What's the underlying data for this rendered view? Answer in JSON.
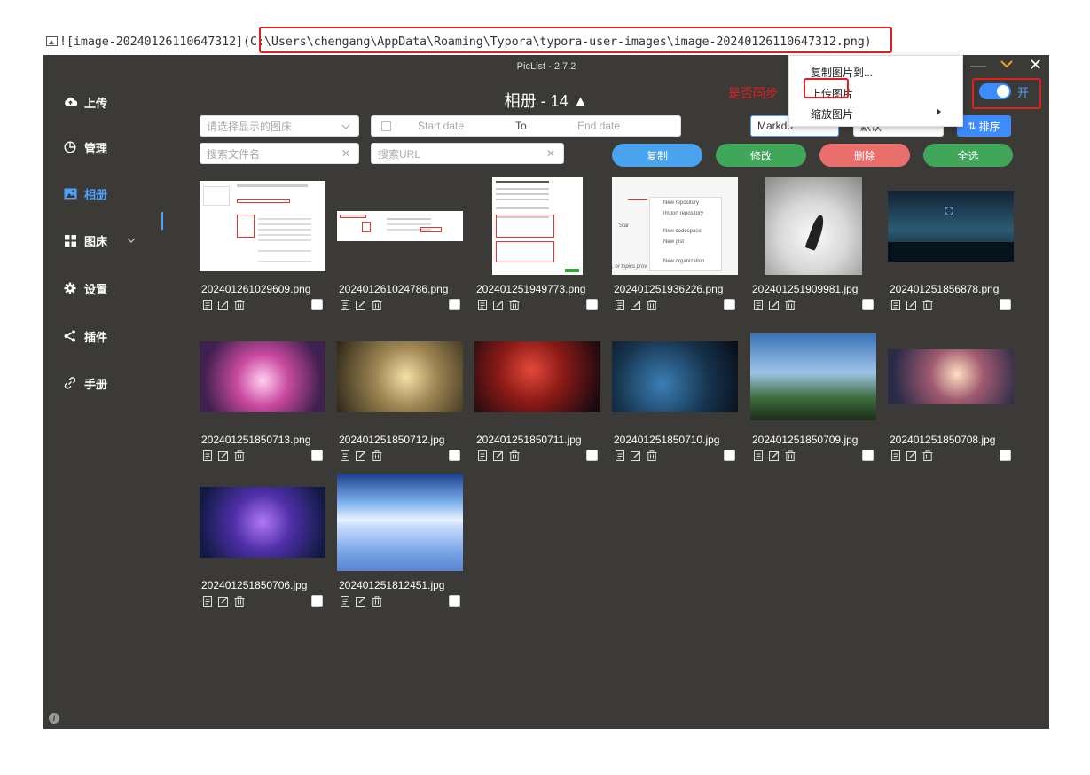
{
  "markdown": {
    "icon": "image-file-icon",
    "prefix": "![image-20240126110647312]",
    "path": "(C:\\Users\\chengang\\AppData\\Roaming\\Typora\\typora-user-images\\image-20240126110647312.png)"
  },
  "window": {
    "title": "PicList - 2.7.2",
    "controls": [
      "minimize-icon",
      "collapse-icon",
      "close-icon"
    ]
  },
  "sidebar": {
    "items": [
      {
        "label": "上传",
        "icon": "cloud-upload-icon"
      },
      {
        "label": "管理",
        "icon": "pie-chart-icon"
      },
      {
        "label": "相册",
        "icon": "picture-icon"
      },
      {
        "label": "图床",
        "icon": "grid-icon"
      },
      {
        "label": "设置",
        "icon": "gear-icon"
      },
      {
        "label": "插件",
        "icon": "share-icon"
      },
      {
        "label": "手册",
        "icon": "link-icon"
      }
    ],
    "active": "相册"
  },
  "header": {
    "title": "相册 - 14 ▲",
    "sync_label": "是否同步",
    "toggle_label": "开",
    "toggle_on": true
  },
  "filters": {
    "bed_placeholder": "请选择显示的图床",
    "start_date": "Start date",
    "to": "To",
    "end_date": "End date",
    "format_value": "Markdo",
    "rename_value": "默认",
    "sort_label": "排序",
    "filename_placeholder": "搜索文件名",
    "url_placeholder": "搜索URL"
  },
  "actions": {
    "copy": "复制",
    "edit": "修改",
    "delete": "删除",
    "select_all": "全选"
  },
  "colors": {
    "copy": "#4aa3ee",
    "edit": "#3fa65a",
    "delete": "#e86f6c",
    "select_all": "#3fa65a",
    "sort": "#3d8bfd",
    "accent": "#4ea1ff",
    "highlight": "#e02020"
  },
  "gallery": [
    {
      "name": "202401261029609.png",
      "type": "screenshot-settings"
    },
    {
      "name": "202401261024786.png",
      "type": "screenshot-wide"
    },
    {
      "name": "202401251949773.png",
      "type": "screenshot-form"
    },
    {
      "name": "202401251936226.png",
      "type": "screenshot-menu"
    },
    {
      "name": "202401251909981.jpg",
      "type": "bw-art"
    },
    {
      "name": "202401251856878.png",
      "type": "deer-night"
    },
    {
      "name": "202401251850713.png",
      "type": "pink-sky"
    },
    {
      "name": "202401251850712.jpg",
      "type": "golden-forest"
    },
    {
      "name": "202401251850711.jpg",
      "type": "red-space"
    },
    {
      "name": "202401251850710.jpg",
      "type": "blue-night"
    },
    {
      "name": "202401251850709.jpg",
      "type": "clouds-field"
    },
    {
      "name": "202401251850708.jpg",
      "type": "sunset-girl"
    },
    {
      "name": "202401251850706.jpg",
      "type": "purple-nebula"
    },
    {
      "name": "202401251812451.jpg",
      "type": "sky-reflection"
    }
  ],
  "context_menu": {
    "items": [
      "复制图片到...",
      "上传图片",
      "缩放图片"
    ]
  },
  "screenshot_text": {
    "menu_items": [
      "New repository",
      "Import repository",
      "New codespace",
      "New gist",
      "New organization"
    ],
    "star": "Star",
    "topics_hint": ", or topics prov"
  }
}
